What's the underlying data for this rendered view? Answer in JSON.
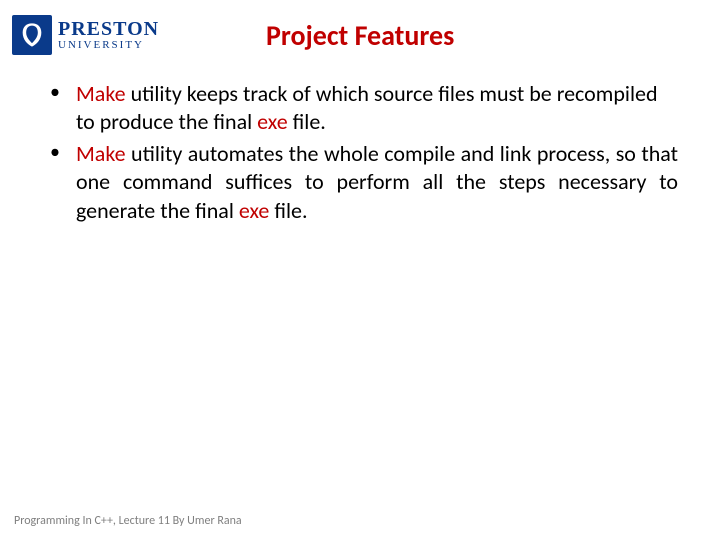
{
  "logo": {
    "main": "PRESTON",
    "sub": "UNIVERSITY"
  },
  "title": "Project Features",
  "bullets": [
    {
      "segments": [
        {
          "text": "Make",
          "kw": true
        },
        {
          "text": " utility keeps track of which source files must be recompiled to produce the final ",
          "kw": false
        },
        {
          "text": "exe",
          "kw": true
        },
        {
          "text": " file.",
          "kw": false
        }
      ],
      "justify": false
    },
    {
      "segments": [
        {
          "text": "Make",
          "kw": true
        },
        {
          "text": " utility automates the whole compile and link process, so that one command suffices to perform all the steps necessary to generate the final ",
          "kw": false
        },
        {
          "text": "exe",
          "kw": true
        },
        {
          "text": " file.",
          "kw": false
        }
      ],
      "justify": true
    }
  ],
  "footer": "Programming In C++, Lecture 11 By Umer Rana"
}
